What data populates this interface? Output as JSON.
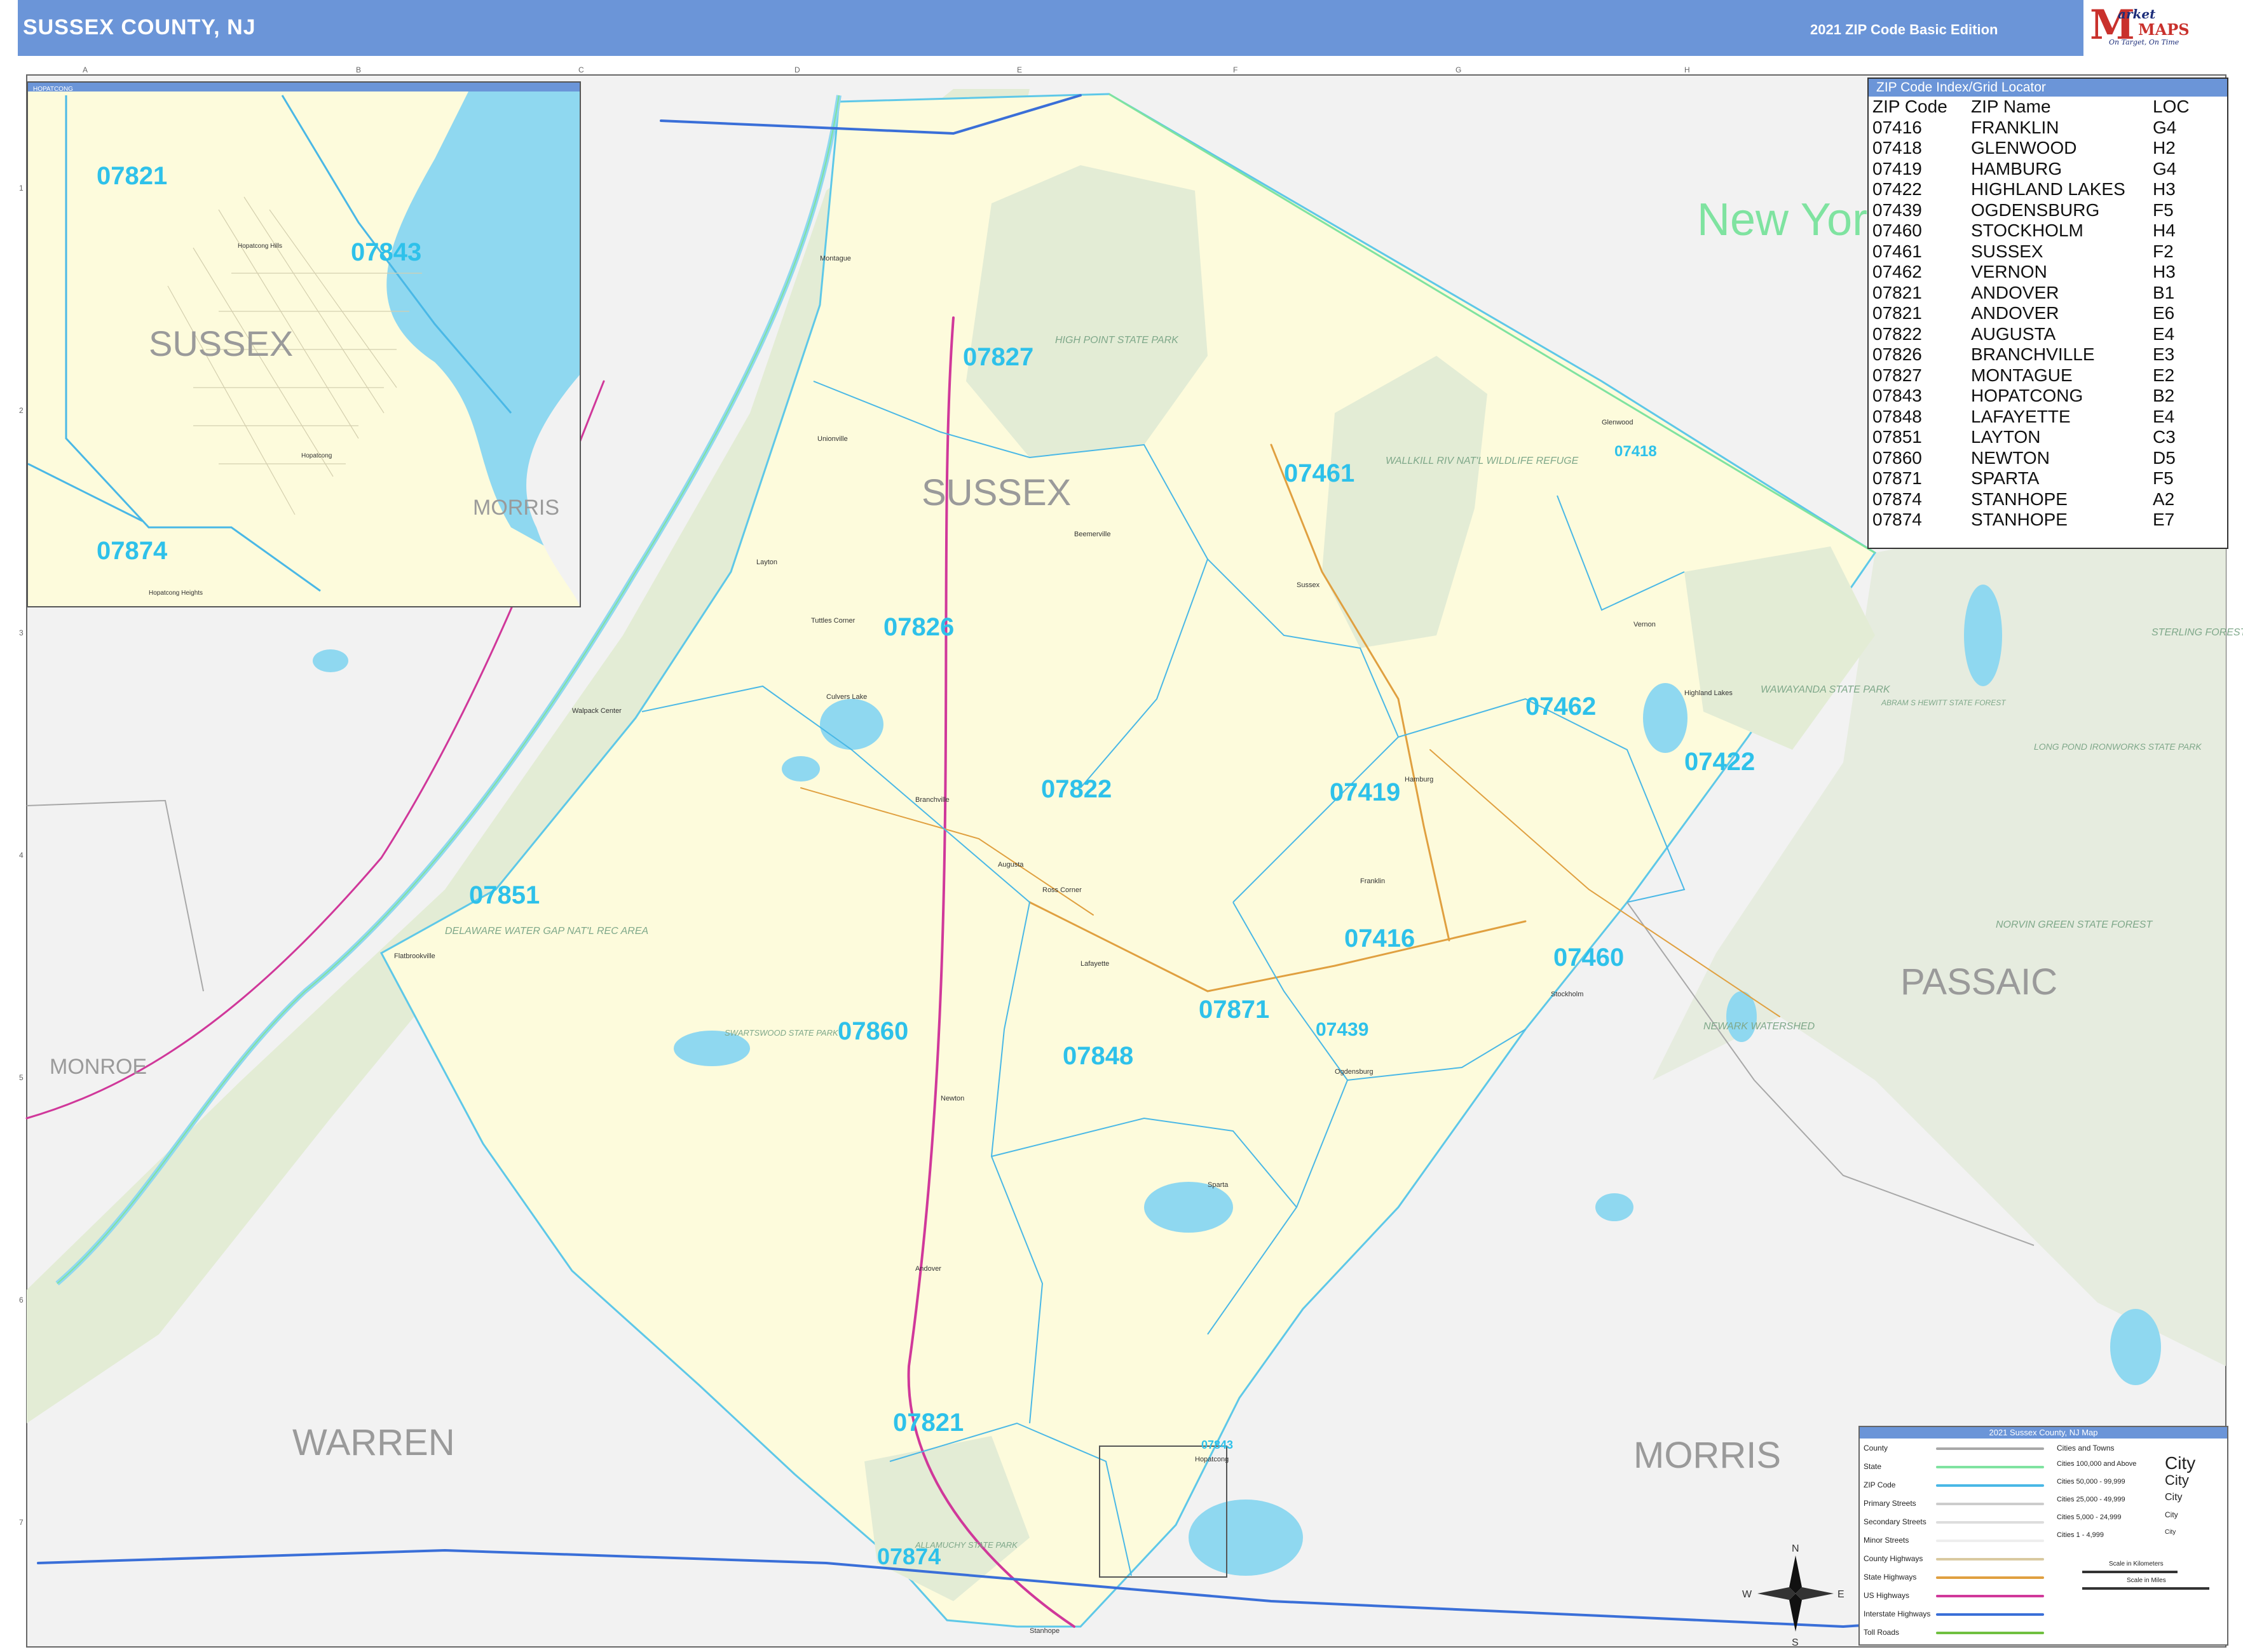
{
  "header": {
    "title": "SUSSEX COUNTY, NJ",
    "edition": "2021 ZIP Code Basic Edition",
    "logo": {
      "m": "M",
      "market": "arket",
      "maps": "MAPS",
      "tagline": "On Target, On Time"
    }
  },
  "grid": {
    "columns": [
      "A",
      "B",
      "C",
      "D",
      "E",
      "F",
      "G",
      "H"
    ],
    "rows": [
      "1",
      "2",
      "3",
      "4",
      "5",
      "6",
      "7"
    ]
  },
  "inset": {
    "title": "HOPATCONG",
    "zip_labels": [
      "07821",
      "07843",
      "07874"
    ],
    "county_labels": [
      "SUSSEX",
      "MORRIS"
    ],
    "places": [
      "Hopatcong Hills",
      "Hopatcong",
      "Hopatcong Heights"
    ]
  },
  "map_labels": {
    "zips": [
      "07827",
      "07461",
      "07418",
      "07826",
      "07462",
      "07422",
      "07822",
      "07419",
      "07851",
      "07416",
      "07460",
      "07860",
      "07871",
      "07439",
      "07848",
      "07821",
      "07874",
      "07843"
    ],
    "counties": [
      "SUSSEX",
      "WARREN",
      "MORRIS",
      "PASSAIC",
      "MONROE"
    ],
    "state": "New York",
    "parks": [
      "HIGH POINT STATE PARK",
      "WALLKILL RIV NAT'L WILDLIFE REFUGE",
      "DELAWARE WATER GAP NAT'L REC AREA",
      "WAWAYANDA STATE PARK",
      "NEWARK WATERSHED",
      "SWARTSWOOD STATE PARK",
      "ALLAMUCHY STATE PARK",
      "STERLING FOREST",
      "NORVIN GREEN STATE FOREST",
      "LONG POND IRONWORKS STATE PARK",
      "ABRAM S HEWITT STATE FOREST"
    ],
    "places": [
      "Montague",
      "Unionville",
      "Layton",
      "Tuttles Corner",
      "Branchville",
      "Augusta",
      "Ross Corner",
      "Lafayette",
      "Newton",
      "Andover",
      "Sparta",
      "Franklin",
      "Hamburg",
      "Vernon",
      "Sussex",
      "Stockholm",
      "Highland Lakes",
      "Ogdensburg",
      "Stanhope",
      "Hopatcong",
      "Walpack Center",
      "Flatbrookville",
      "Culvers Lake",
      "Glenwood",
      "Beemerville"
    ]
  },
  "index": {
    "title": "ZIP Code Index/Grid Locator",
    "columns": [
      "ZIP Code",
      "ZIP Name",
      "LOC"
    ],
    "rows": [
      [
        "07416",
        "FRANKLIN",
        "G4"
      ],
      [
        "07418",
        "GLENWOOD",
        "H2"
      ],
      [
        "07419",
        "HAMBURG",
        "G4"
      ],
      [
        "07422",
        "HIGHLAND LAKES",
        "H3"
      ],
      [
        "07439",
        "OGDENSBURG",
        "F5"
      ],
      [
        "07460",
        "STOCKHOLM",
        "H4"
      ],
      [
        "07461",
        "SUSSEX",
        "F2"
      ],
      [
        "07462",
        "VERNON",
        "H3"
      ],
      [
        "07821",
        "ANDOVER",
        "B1"
      ],
      [
        "07821",
        "ANDOVER",
        "E6"
      ],
      [
        "07822",
        "AUGUSTA",
        "E4"
      ],
      [
        "07826",
        "BRANCHVILLE",
        "E3"
      ],
      [
        "07827",
        "MONTAGUE",
        "E2"
      ],
      [
        "07843",
        "HOPATCONG",
        "B2"
      ],
      [
        "07848",
        "LAFAYETTE",
        "E4"
      ],
      [
        "07851",
        "LAYTON",
        "C3"
      ],
      [
        "07860",
        "NEWTON",
        "D5"
      ],
      [
        "07871",
        "SPARTA",
        "F5"
      ],
      [
        "07874",
        "STANHOPE",
        "A2"
      ],
      [
        "07874",
        "STANHOPE",
        "E7"
      ]
    ]
  },
  "legend": {
    "title": "2021 Sussex County, NJ Map",
    "items": [
      {
        "label": "County",
        "color": "#a8a8a8"
      },
      {
        "label": "State",
        "color": "#7fe3a0"
      },
      {
        "label": "ZIP Code",
        "color": "#4ab8e6"
      },
      {
        "label": "Primary Streets",
        "color": "#cccccc"
      },
      {
        "label": "Secondary Streets",
        "color": "#dddddd"
      },
      {
        "label": "Minor Streets",
        "color": "#eeeeee"
      },
      {
        "label": "County Highways",
        "color": "#d9c9a0"
      },
      {
        "label": "State Highways",
        "color": "#e0a040"
      },
      {
        "label": "US Highways",
        "color": "#d0389a"
      },
      {
        "label": "Interstate Highways",
        "color": "#3a6fd8"
      },
      {
        "label": "Toll Roads",
        "color": "#70c040"
      }
    ],
    "cities_title": "Cities and Towns",
    "cities": [
      {
        "label": "Cities 100,000 and Above",
        "sample": "City"
      },
      {
        "label": "Cities 50,000 - 99,999",
        "sample": "City"
      },
      {
        "label": "Cities 25,000 - 49,999",
        "sample": "City"
      },
      {
        "label": "Cities 5,000 - 24,999",
        "sample": "City"
      },
      {
        "label": "Cities 1 - 4,999",
        "sample": "City"
      }
    ],
    "scale_km": "Scale in Kilometers",
    "scale_mi": "Scale in Miles",
    "compass": [
      "N",
      "S",
      "E",
      "W"
    ]
  },
  "colors": {
    "county_fill": "#fdfbdc",
    "park_fill": "#e3ecd5",
    "water": "#8fd8f0",
    "zip_line": "#4ab8e6",
    "header": "#6b95d8"
  }
}
